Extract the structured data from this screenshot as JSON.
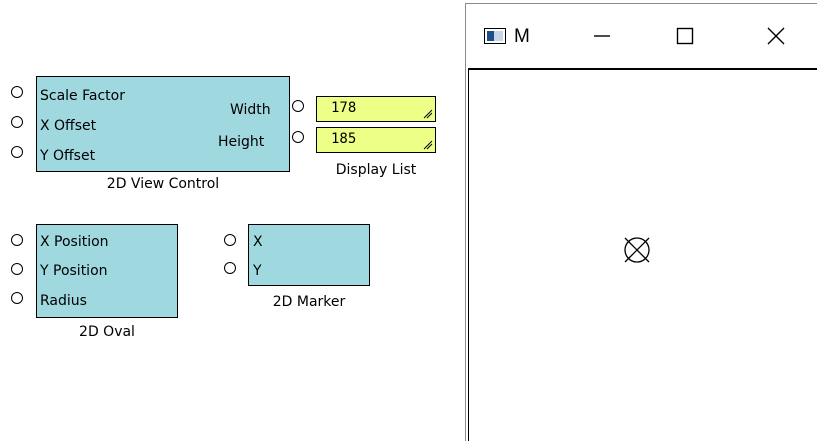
{
  "canvas": {
    "view_control": {
      "name": "2D View Control",
      "inputs": [
        "Scale Factor",
        "X Offset",
        "Y Offset"
      ],
      "outputs": [
        "Width",
        "Height"
      ]
    },
    "display_list": {
      "name": "Display List",
      "values": [
        "178",
        "185"
      ]
    },
    "oval": {
      "name": "2D Oval",
      "inputs": [
        "X Position",
        "Y Position",
        "Radius"
      ]
    },
    "marker": {
      "name": "2D Marker",
      "inputs": [
        "X",
        "Y"
      ]
    }
  },
  "window": {
    "title": "M",
    "icon": "app-icon",
    "buttons": [
      "minimize-icon",
      "maximize-icon",
      "close-icon"
    ]
  },
  "colors": {
    "block_fill": "#a0d8e0",
    "value_fill": "#eeff88"
  }
}
